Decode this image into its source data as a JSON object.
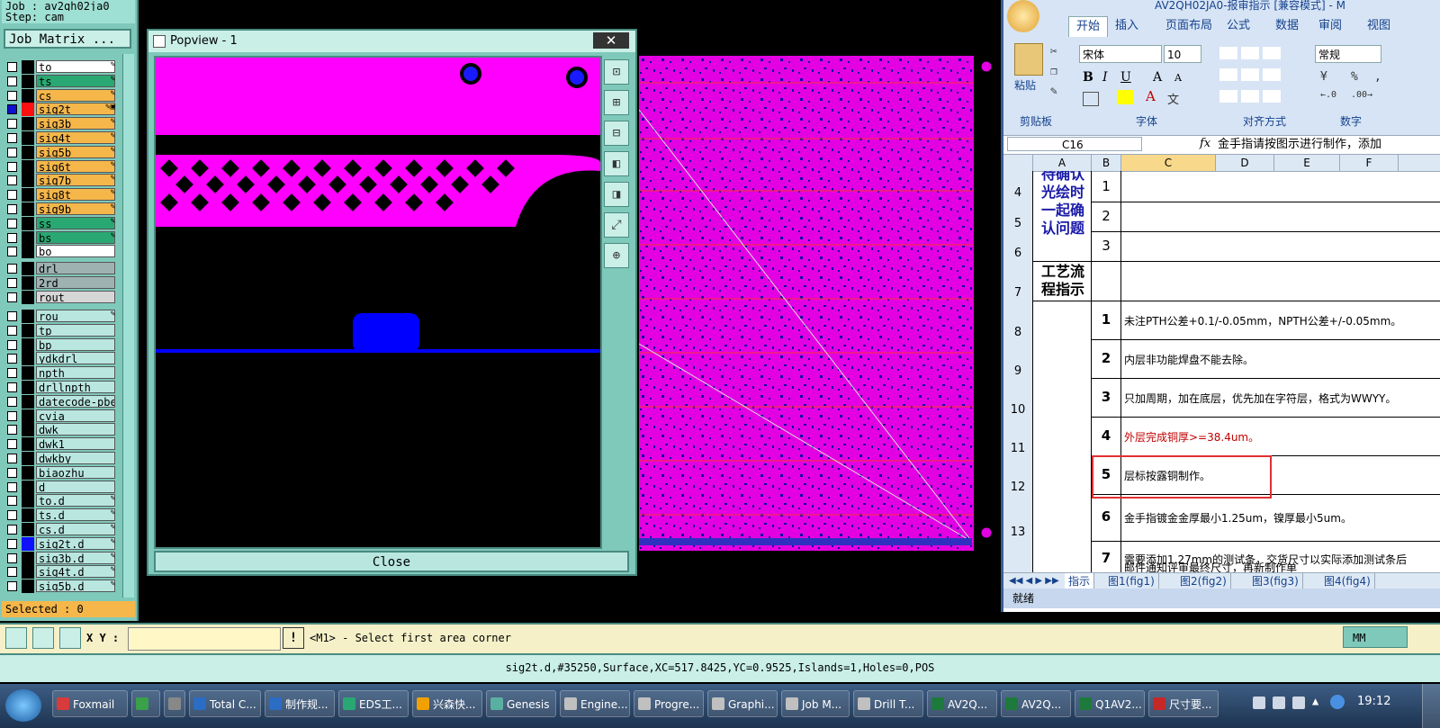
{
  "genesis": {
    "job_line": "Job : av2qh02ja0",
    "step_line": "Step: cam",
    "job_matrix_label": "Job Matrix ...",
    "layers_top": [
      {
        "name": "to",
        "cls": "wh",
        "mark": "✎"
      },
      {
        "name": "ts",
        "cls": "gr",
        "mark": "✎"
      },
      {
        "name": "cs",
        "cls": "or",
        "mark": "✎"
      },
      {
        "name": "sig2t",
        "cls": "or",
        "mark": "✎▣"
      },
      {
        "name": "sig3b",
        "cls": "or",
        "mark": "✎"
      },
      {
        "name": "sig4t",
        "cls": "or",
        "mark": "✎"
      },
      {
        "name": "sig5b",
        "cls": "or",
        "mark": "✎"
      },
      {
        "name": "sig6t",
        "cls": "or",
        "mark": "✎"
      },
      {
        "name": "sig7b",
        "cls": "or",
        "mark": "✎"
      },
      {
        "name": "sig8t",
        "cls": "or",
        "mark": "✎"
      },
      {
        "name": "sig9b",
        "cls": "or",
        "mark": "✎"
      },
      {
        "name": "ss",
        "cls": "gr",
        "mark": "✎"
      },
      {
        "name": "bs",
        "cls": "gr",
        "mark": "✎"
      },
      {
        "name": "bo",
        "cls": "wh",
        "mark": ""
      }
    ],
    "layers_drill": [
      {
        "name": "drl",
        "cls": "gy"
      },
      {
        "name": "2rd",
        "cls": "gy"
      },
      {
        "name": "rout",
        "cls": "gy2"
      }
    ],
    "layers_misc": [
      {
        "name": "rou",
        "cls": "lc",
        "mark": "✎"
      },
      {
        "name": "tp",
        "cls": "lc",
        "mark": ""
      },
      {
        "name": "bp",
        "cls": "lc",
        "mark": ""
      },
      {
        "name": "ydkdrl",
        "cls": "lc",
        "mark": ""
      },
      {
        "name": "npth",
        "cls": "lc",
        "mark": ""
      },
      {
        "name": "drllnpth",
        "cls": "lc",
        "mark": ""
      },
      {
        "name": "datecode-pbe",
        "cls": "lc",
        "mark": ""
      },
      {
        "name": "cvia",
        "cls": "lc",
        "mark": ""
      },
      {
        "name": "dwk",
        "cls": "lc",
        "mark": ""
      },
      {
        "name": "dwk1",
        "cls": "lc",
        "mark": ""
      },
      {
        "name": "dwkby",
        "cls": "lc",
        "mark": ""
      },
      {
        "name": "biaozhu",
        "cls": "lc",
        "mark": ""
      },
      {
        "name": "d",
        "cls": "lc",
        "mark": ""
      },
      {
        "name": "to.d",
        "cls": "lc",
        "mark": "✎"
      },
      {
        "name": "ts.d",
        "cls": "lc",
        "mark": "✎"
      },
      {
        "name": "cs.d",
        "cls": "lc",
        "mark": "✎"
      },
      {
        "name": "sig2t.d",
        "cls": "lc",
        "mark": "✎"
      },
      {
        "name": "sig3b.d",
        "cls": "lc",
        "mark": "✎"
      },
      {
        "name": "sig4t.d",
        "cls": "lc",
        "mark": "✎"
      },
      {
        "name": "sig5b.d",
        "cls": "lc",
        "mark": "✎"
      }
    ],
    "selected": "Selected : 0",
    "popview_title": "Popview - 1",
    "popview_close_x": "✕",
    "close_button": "Close",
    "xy_label": "X Y :",
    "xy_value": "",
    "warn_icon": "!",
    "prompt": "<M1> - Select first area corner",
    "units_button": "MM",
    "status_line": "sig2t.d,#35250,Surface,XC=517.8425,YC=0.9525,Islands=1,Holes=0,POS"
  },
  "excel": {
    "title": "AV2QH02JA0-报审指示 [兼容模式] - M",
    "tabs": [
      "开始",
      "插入",
      "页面布局",
      "公式",
      "数据",
      "审阅",
      "视图"
    ],
    "font_name": "宋体",
    "font_size": "10",
    "number_format": "常规",
    "paste_label": "粘贴",
    "groups": [
      "剪贴板",
      "字体",
      "对齐方式",
      "数字"
    ],
    "name_box": "C16",
    "fx": "fx",
    "formula": "金手指请按图示进行制作，添加",
    "columns": [
      "A",
      "B",
      "C",
      "D",
      "E",
      "F"
    ],
    "row_numbers": [
      "4",
      "5",
      "6",
      "7",
      "8",
      "9",
      "10",
      "11",
      "12",
      "13"
    ],
    "merged_a_top": "待确认光绘时一起确认问题",
    "merged_a_label": "工艺流程指示",
    "b_top": [
      "1",
      "2",
      "3"
    ],
    "items": [
      {
        "num": "1",
        "text": "未注PTH公差+0.1/-0.05mm，NPTH公差+/-0.05mm。",
        "color": "#000"
      },
      {
        "num": "2",
        "text": "内层非功能焊盘不能去除。",
        "color": "#000"
      },
      {
        "num": "3",
        "text": "只加周期，加在底层，优先加在字符层，格式为WWYY。",
        "color": "#000"
      },
      {
        "num": "4",
        "text": "外层完成铜厚>=38.4um。",
        "color": "#c00000"
      },
      {
        "num": "5",
        "text": "层标按露铜制作。",
        "color": "#000"
      },
      {
        "num": "6",
        "text": "金手指镀金金厚最小1.25um，镍厚最小5um。",
        "color": "#000"
      },
      {
        "num": "7",
        "text": "需要添加1.27mm的测试条，交货尺寸以实际添加测试条后",
        "color": "#000"
      }
    ],
    "item7_line2": "邮件通知评审最终尺寸，再新制作单",
    "sheet_tabs": [
      "指示",
      "图1(fig1)",
      "图2(fig2)",
      "图3(fig3)",
      "图4(fig4)"
    ],
    "status": "就绪"
  },
  "taskbar": {
    "items": [
      {
        "label": "Foxmail",
        "color": "#d83b3b"
      },
      {
        "label": "",
        "color": "#3aa04a"
      },
      {
        "label": "",
        "color": "#888"
      },
      {
        "label": "Total C...",
        "color": "#2b6cc4"
      },
      {
        "label": "制作规...",
        "color": "#2b6cc4"
      },
      {
        "label": "EDS工...",
        "color": "#2aa873"
      },
      {
        "label": "兴森快...",
        "color": "#f0a000"
      },
      {
        "label": "Genesis",
        "color": "#5ab0a0"
      },
      {
        "label": "Engine...",
        "color": "#c0c0c0"
      },
      {
        "label": "Progre...",
        "color": "#c0c0c0"
      },
      {
        "label": "Graphi...",
        "color": "#c0c0c0"
      },
      {
        "label": "Job M...",
        "color": "#c0c0c0"
      },
      {
        "label": "Drill T...",
        "color": "#c0c0c0"
      },
      {
        "label": "AV2Q...",
        "color": "#1e7a3c"
      },
      {
        "label": "AV2Q...",
        "color": "#1e7a3c"
      },
      {
        "label": "Q1AV2...",
        "color": "#1e7a3c"
      },
      {
        "label": "尺寸要...",
        "color": "#c62828"
      }
    ],
    "clock": "19:12"
  }
}
